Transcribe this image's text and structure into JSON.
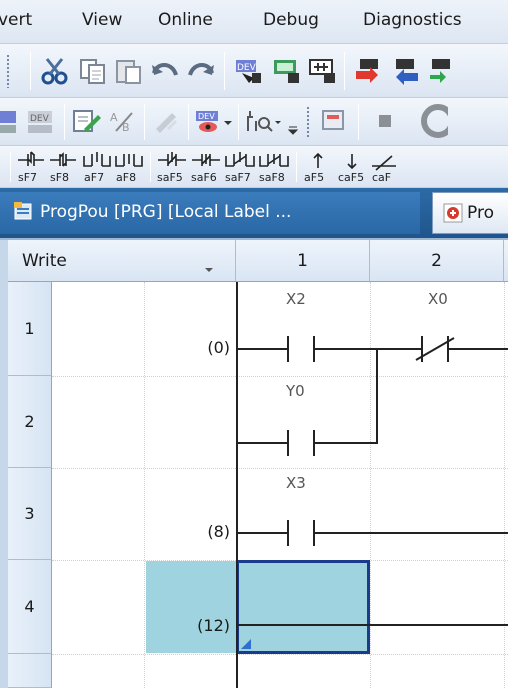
{
  "menu": {
    "items": [
      "vert",
      "View",
      "Online",
      "Debug",
      "Diagnostics"
    ]
  },
  "toolbar3": {
    "items": [
      "sF7",
      "sF8",
      "aF7",
      "aF8",
      "saF5",
      "saF6",
      "saF7",
      "saF8",
      "aF5",
      "caF5",
      "caF"
    ]
  },
  "tabs": {
    "active_label": "ProgPou [PRG] [Local Label ...",
    "inactive_label": "Pro"
  },
  "ladder": {
    "mode_label": "Write",
    "columns": [
      "1",
      "2"
    ],
    "rows": [
      {
        "num": "1",
        "step": "(0)",
        "contacts": [
          "X2",
          "X0"
        ]
      },
      {
        "num": "2",
        "step": "",
        "contacts": [
          "Y0"
        ]
      },
      {
        "num": "3",
        "step": "(8)",
        "contacts": [
          "X3"
        ]
      },
      {
        "num": "4",
        "step": "(12)",
        "contacts": []
      }
    ]
  },
  "colors": {
    "tab_bar": "#2c6ba8",
    "selected_cell": "#9fd3df",
    "cursor_border": "#1a3c8c"
  }
}
